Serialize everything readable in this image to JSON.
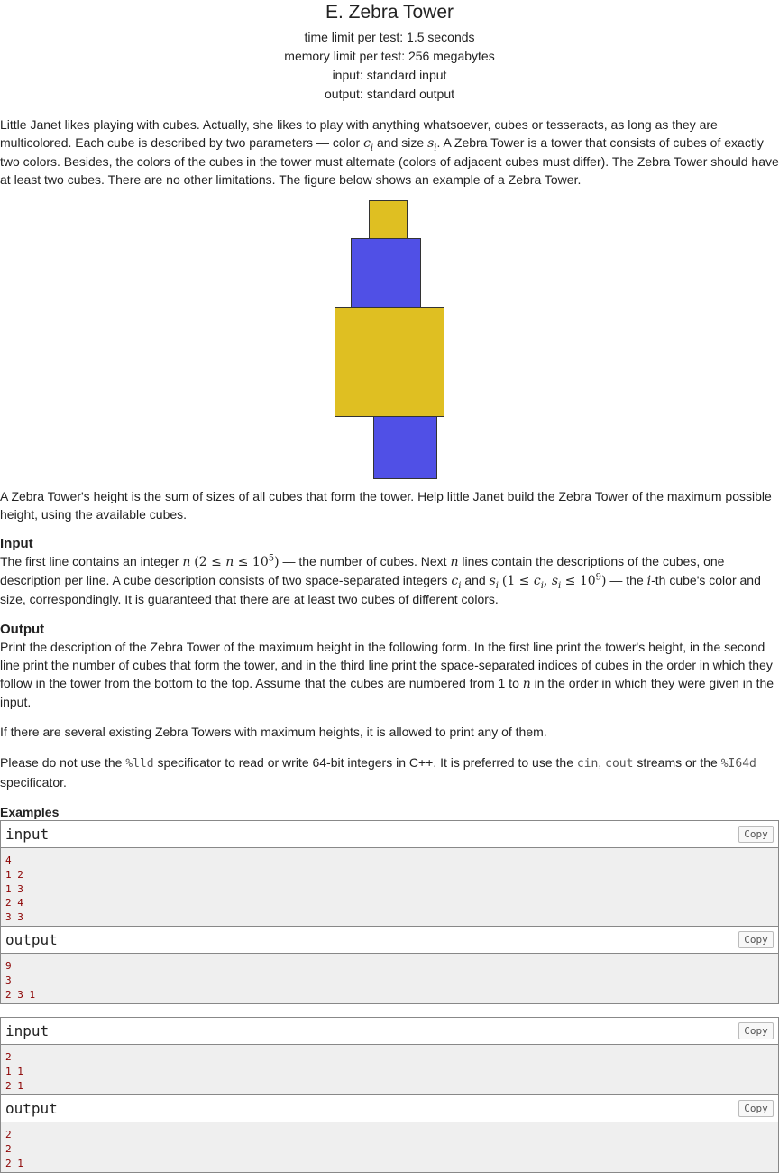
{
  "problem": {
    "title": "E. Zebra Tower",
    "time_limit": "time limit per test: 1.5 seconds",
    "memory_limit": "memory limit per test: 256 megabytes",
    "input_spec": "input: standard input",
    "output_spec": "output: standard output"
  },
  "statement": {
    "p1_a": "Little Janet likes playing with cubes. Actually, she likes to play with anything whatsoever, cubes or tesseracts, as long as they are multicolored. Each cube is described by two parameters — color ",
    "p1_b": " and size ",
    "p1_c": ". A Zebra Tower is a tower that consists of cubes of exactly two colors. Besides, the colors of the cubes in the tower must alternate (colors of adjacent cubes must differ). The Zebra Tower should have at least two cubes. There are no other limitations. The figure below shows an example of a Zebra Tower.",
    "p2": "A Zebra Tower's height is the sum of sizes of all cubes that form the tower. Help little Janet build the Zebra Tower of the maximum possible height, using the available cubes."
  },
  "figure": {
    "colors": {
      "yellow": "#dfbf22",
      "blue": "#5050e6",
      "border": "#333333"
    }
  },
  "input_section": {
    "title": "Input",
    "a": "The first line contains an integer ",
    "b": " — the number of cubes. Next ",
    "c": " lines contain the descriptions of the cubes, one description per line. A cube description consists of two space-separated integers ",
    "d": " and ",
    "e": " — the ",
    "f": "-th cube's color and size, correspondingly. It is guaranteed that there are at least two cubes of different colors."
  },
  "output_section": {
    "title": "Output",
    "a": "Print the description of the Zebra Tower of the maximum height in the following form. In the first line print the tower's height, in the second line print the number of cubes that form the tower, and in the third line print the space-separated indices of cubes in the order in which they follow in the tower from the bottom to the top. Assume that the cubes are numbered from 1 to ",
    "b": " in the order in which they were given in the input.",
    "p2": "If there are several existing Zebra Towers with maximum heights, it is allowed to print any of them.",
    "p3_a": "Please do not use the ",
    "p3_code1": "%lld",
    "p3_b": " specificator to read or write 64-bit integers in C++. It is preferred to use the ",
    "p3_code2": "cin",
    "p3_c": ", ",
    "p3_code3": "cout",
    "p3_d": " streams or the ",
    "p3_code4": "%I64d",
    "p3_e": " specificator."
  },
  "examples": {
    "title": "Examples",
    "copy_label": "Copy",
    "input_label": "input",
    "output_label": "output",
    "tests": [
      {
        "input": [
          "4",
          "1 2",
          "1 3",
          "2 4",
          "3 3"
        ],
        "output": [
          "9",
          "3",
          "2 3 1"
        ]
      },
      {
        "input": [
          "2",
          "1 1",
          "2 1"
        ],
        "output": [
          "2",
          "2",
          "2 1"
        ]
      }
    ]
  }
}
